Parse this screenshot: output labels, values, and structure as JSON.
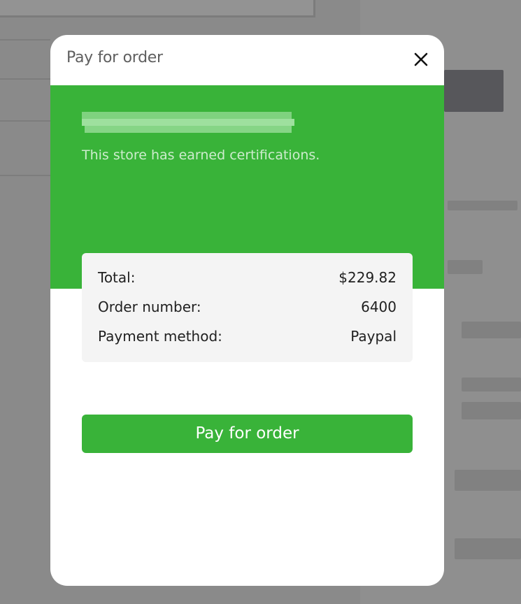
{
  "modal": {
    "title": "Pay for order",
    "close_icon": "close-icon"
  },
  "store": {
    "name_redacted": true,
    "caption": "This store has earned certifications."
  },
  "summary": {
    "rows": [
      {
        "label": "Total:",
        "value": "$229.82"
      },
      {
        "label": "Order number:",
        "value": "6400"
      },
      {
        "label": "Payment method:",
        "value": "Paypal"
      }
    ]
  },
  "actions": {
    "pay_label": "Pay for order"
  },
  "colors": {
    "accent_green": "#39b339",
    "overlay": "#8a8a8a",
    "card_bg": "#f4f4f4"
  }
}
